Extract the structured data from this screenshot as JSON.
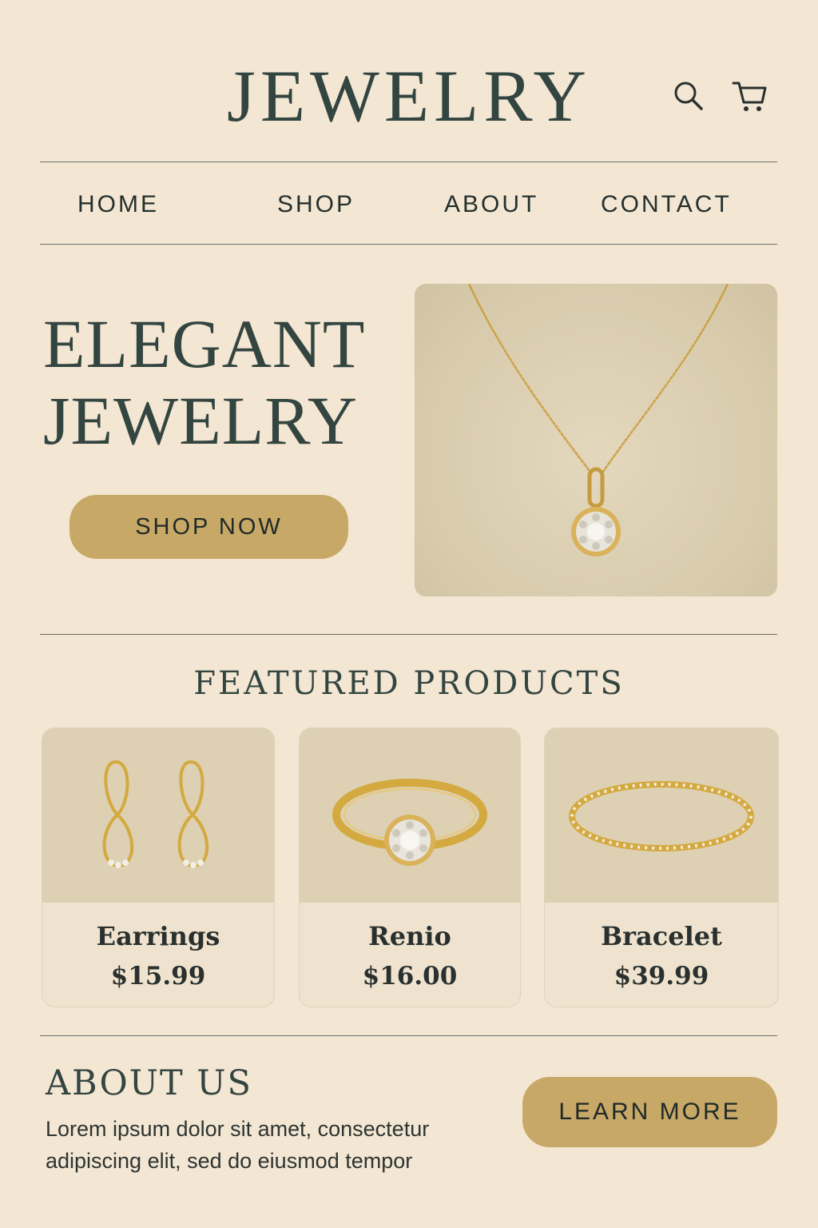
{
  "header": {
    "brand": "JEWELRY",
    "icons": {
      "search": "search-icon",
      "cart": "cart-icon"
    }
  },
  "nav": {
    "items": [
      {
        "label": "HOME"
      },
      {
        "label": "SHOP"
      },
      {
        "label": "ABOUT"
      },
      {
        "label": "CONTACT"
      }
    ]
  },
  "hero": {
    "title_line1": "ELEGANT",
    "title_line2": "JEWELRY",
    "cta_label": "SHOP NOW"
  },
  "featured": {
    "title": "FEATURED PRODUCTS",
    "products": [
      {
        "name": "Earrings",
        "price": "$15.99"
      },
      {
        "name": "Renio",
        "price": "$16.00"
      },
      {
        "name": "Bracelet",
        "price": "$39.99"
      }
    ]
  },
  "about": {
    "title": "ABOUT US",
    "text_line1": "Lorem ipsum dolor sit amet, consectetur",
    "text_line2": "adipiscing elit, sed do eiusmod tempor",
    "cta_label": "LEARN MORE"
  },
  "colors": {
    "background": "#f3e6d3",
    "accent": "#c7a867",
    "text": "#334540"
  }
}
